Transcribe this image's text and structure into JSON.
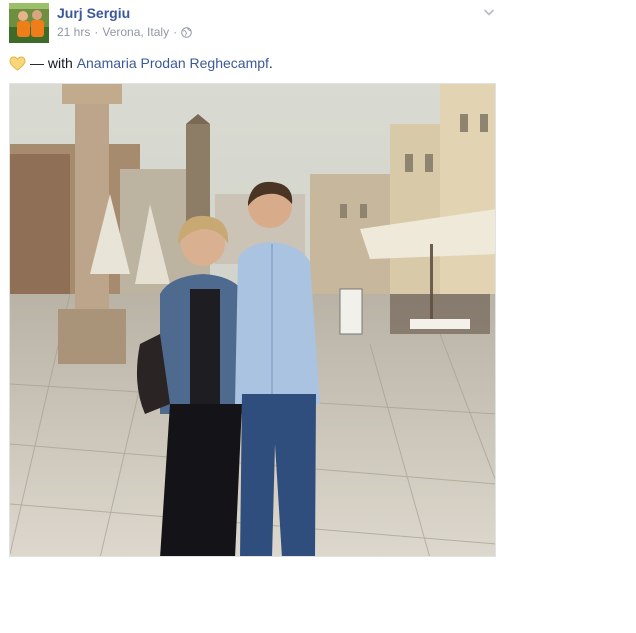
{
  "post": {
    "author": "Jurj Sergiu",
    "time": "21 hrs",
    "separator": "·",
    "location": "Verona, Italy",
    "dash": "—",
    "with_text": "with",
    "tagged": "Anamaria Prodan Reghecampf",
    "period": "."
  },
  "icons": {
    "privacy": "globe-icon",
    "feeling": "heart-icon",
    "options": "chevron-down-icon"
  },
  "colors": {
    "link": "#3b5998",
    "meta": "#9197a3",
    "heart": "#f5c84c"
  }
}
